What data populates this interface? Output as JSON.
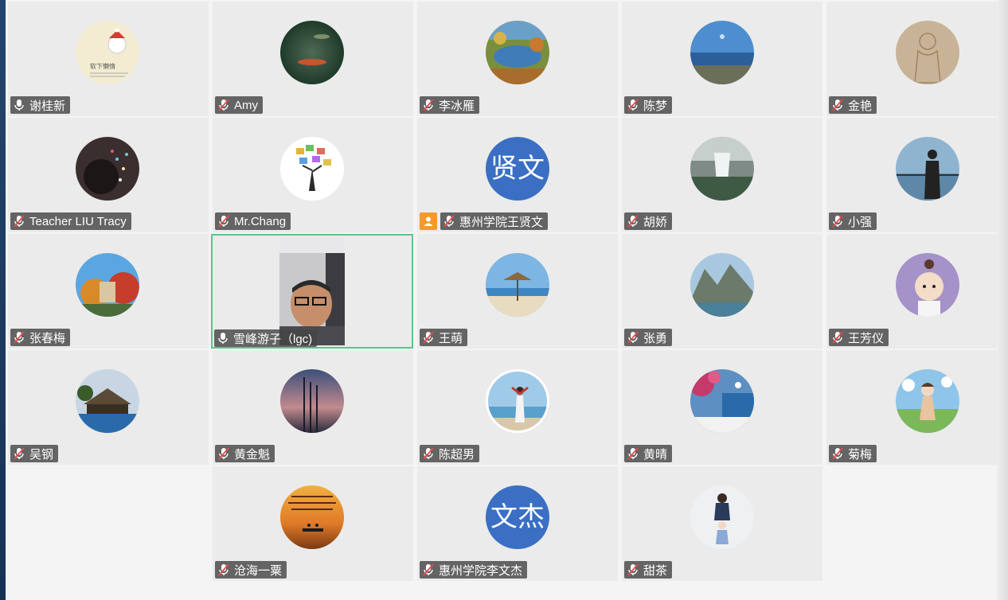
{
  "meeting": {
    "participants": [
      {
        "name": "谢桂新",
        "mic": "on"
      },
      {
        "name": "Amy",
        "mic": "muted"
      },
      {
        "name": "李冰雁",
        "mic": "muted"
      },
      {
        "name": "陈梦",
        "mic": "muted"
      },
      {
        "name": "金艳",
        "mic": "muted"
      },
      {
        "name": "Teacher LIU Tracy",
        "mic": "muted"
      },
      {
        "name": "Mr.Chang",
        "mic": "muted"
      },
      {
        "name": "惠州学院王贤文",
        "mic": "muted",
        "host": true,
        "avatar_text": "贤文"
      },
      {
        "name": "胡娇",
        "mic": "muted"
      },
      {
        "name": "小强",
        "mic": "muted"
      },
      {
        "name": "张春梅",
        "mic": "muted"
      },
      {
        "name": "雪峰游子（lgc)",
        "mic": "on",
        "video": true,
        "speaking": true
      },
      {
        "name": "王萌",
        "mic": "muted"
      },
      {
        "name": "张勇",
        "mic": "muted"
      },
      {
        "name": "王芳仪",
        "mic": "muted"
      },
      {
        "name": "吴钢",
        "mic": "muted"
      },
      {
        "name": "黄金魁",
        "mic": "muted"
      },
      {
        "name": "陈超男",
        "mic": "muted"
      },
      {
        "name": "黄晴",
        "mic": "muted"
      },
      {
        "name": "菊梅",
        "mic": "muted"
      },
      {
        "name": "沧海一粟",
        "mic": "muted"
      },
      {
        "name": "惠州学院李文杰",
        "mic": "muted",
        "avatar_text": "文杰"
      },
      {
        "name": "甜茶",
        "mic": "muted"
      }
    ],
    "avatar_bubble_text": "软下懒惰",
    "colors": {
      "speaking_border": "#5dc58a",
      "host_badge": "#f39a2b",
      "text_avatar": "#3a6fc4"
    }
  }
}
